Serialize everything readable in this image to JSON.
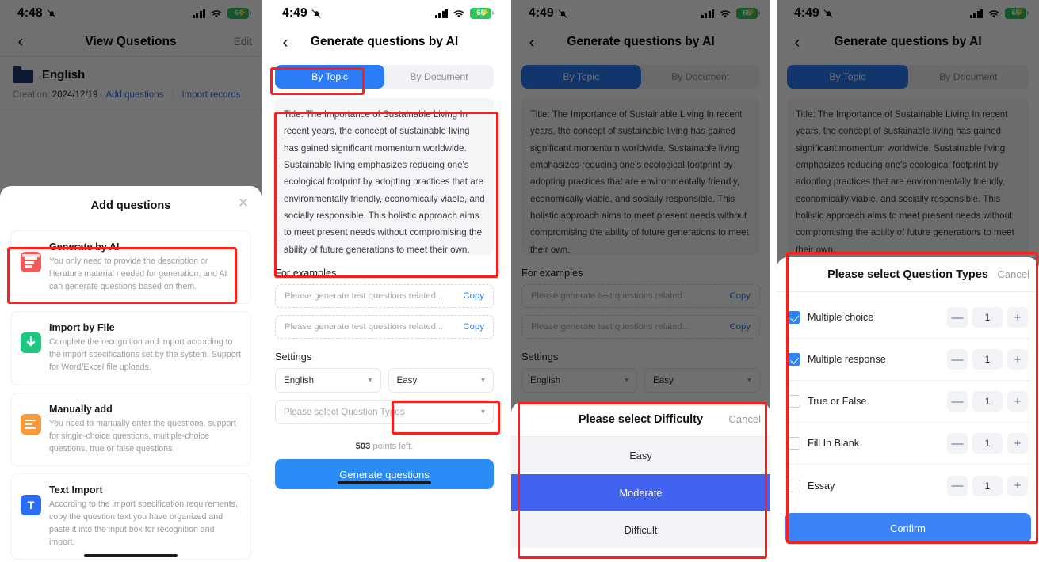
{
  "colors": {
    "accent_blue": "#2b7cf6",
    "button_blue": "#2b8cf8",
    "selected_blue": "#4262f0",
    "annotation_red": "#fe1d18",
    "battery_green": "#2ec45f"
  },
  "panel1": {
    "status": {
      "time": "4:48",
      "battery": "64",
      "icons": [
        "bell-off-icon",
        "cellular-icon",
        "wifi-icon",
        "battery-charging-icon"
      ]
    },
    "nav": {
      "back": "‹",
      "title": "View Qusetions",
      "right": "Edit"
    },
    "folder": {
      "name": "English"
    },
    "meta": {
      "creation_label": "Creation:",
      "creation_date": "2024/12/19",
      "add_questions": "Add questions",
      "divider": "|",
      "import_records": "Import records"
    },
    "sheet": {
      "title": "Add questions",
      "close": "✕",
      "options": [
        {
          "title": "Generate by AI",
          "desc": "You only need to provide the description or literature material needed for generation, and AI can generate questions based on them.",
          "icon": "ai-document-icon",
          "color": "red"
        },
        {
          "title": "Import by File",
          "desc": "Complete the recognition and import according to the import specifications set by the system. Support for Word/Excel file uploads.",
          "icon": "file-download-icon",
          "color": "green"
        },
        {
          "title": "Manually add",
          "desc": "You need to manually enter the questions, support for single-choice questions, multiple-choice questions, true or false questions.",
          "icon": "manual-edit-icon",
          "color": "orange"
        },
        {
          "title": "Text Import",
          "desc": "According to the import specification requirements, copy the question text you have organized and paste it into the input box for recognition and import.",
          "icon": "text-import-icon",
          "color": "blue"
        }
      ]
    }
  },
  "generate": {
    "status": {
      "time": "4:49",
      "battery": "65"
    },
    "nav": {
      "back": "‹",
      "title": "Generate questions by AI"
    },
    "tabs": [
      {
        "label": "By Topic",
        "active": true
      },
      {
        "label": "By Document",
        "active": false
      }
    ],
    "topic_text": "Title: The Importance of Sustainable Living\nIn recent years, the concept of sustainable living has gained significant momentum worldwide. Sustainable living emphasizes reducing one's ecological footprint by adopting practices that are environmentally friendly, economically viable, and socially responsible. This holistic approach aims to meet present needs without compromising the ability of future generations to meet their own.",
    "examples_heading": "For examples",
    "examples": [
      {
        "placeholder": "Please generate test questions related...",
        "copy": "Copy"
      },
      {
        "placeholder": "Please generate test questions related...",
        "copy": "Copy"
      }
    ],
    "settings_heading": "Settings",
    "language_value": "English",
    "difficulty_value": "Easy",
    "question_types_placeholder": "Please select Question Types",
    "chevron": "⌄",
    "points_count": "503",
    "points_suffix": " points left.",
    "generate_button": "Generate questions"
  },
  "difficulty_sheet": {
    "title": "Please select Difficulty",
    "cancel": "Cancel",
    "options": [
      {
        "label": "Easy",
        "selected": false
      },
      {
        "label": "Moderate",
        "selected": true
      },
      {
        "label": "Difficult",
        "selected": false
      }
    ]
  },
  "question_types_sheet": {
    "title": "Please select Question Types",
    "cancel": "Cancel",
    "confirm": "Confirm",
    "minus": "—",
    "plus": "+",
    "rows": [
      {
        "label": "Multiple choice",
        "checked": true,
        "count": "1"
      },
      {
        "label": "Multiple response",
        "checked": true,
        "count": "1"
      },
      {
        "label": "True or False",
        "checked": false,
        "count": "1"
      },
      {
        "label": "Fill In Blank",
        "checked": false,
        "count": "1"
      },
      {
        "label": "Essay",
        "checked": false,
        "count": "1"
      }
    ]
  }
}
